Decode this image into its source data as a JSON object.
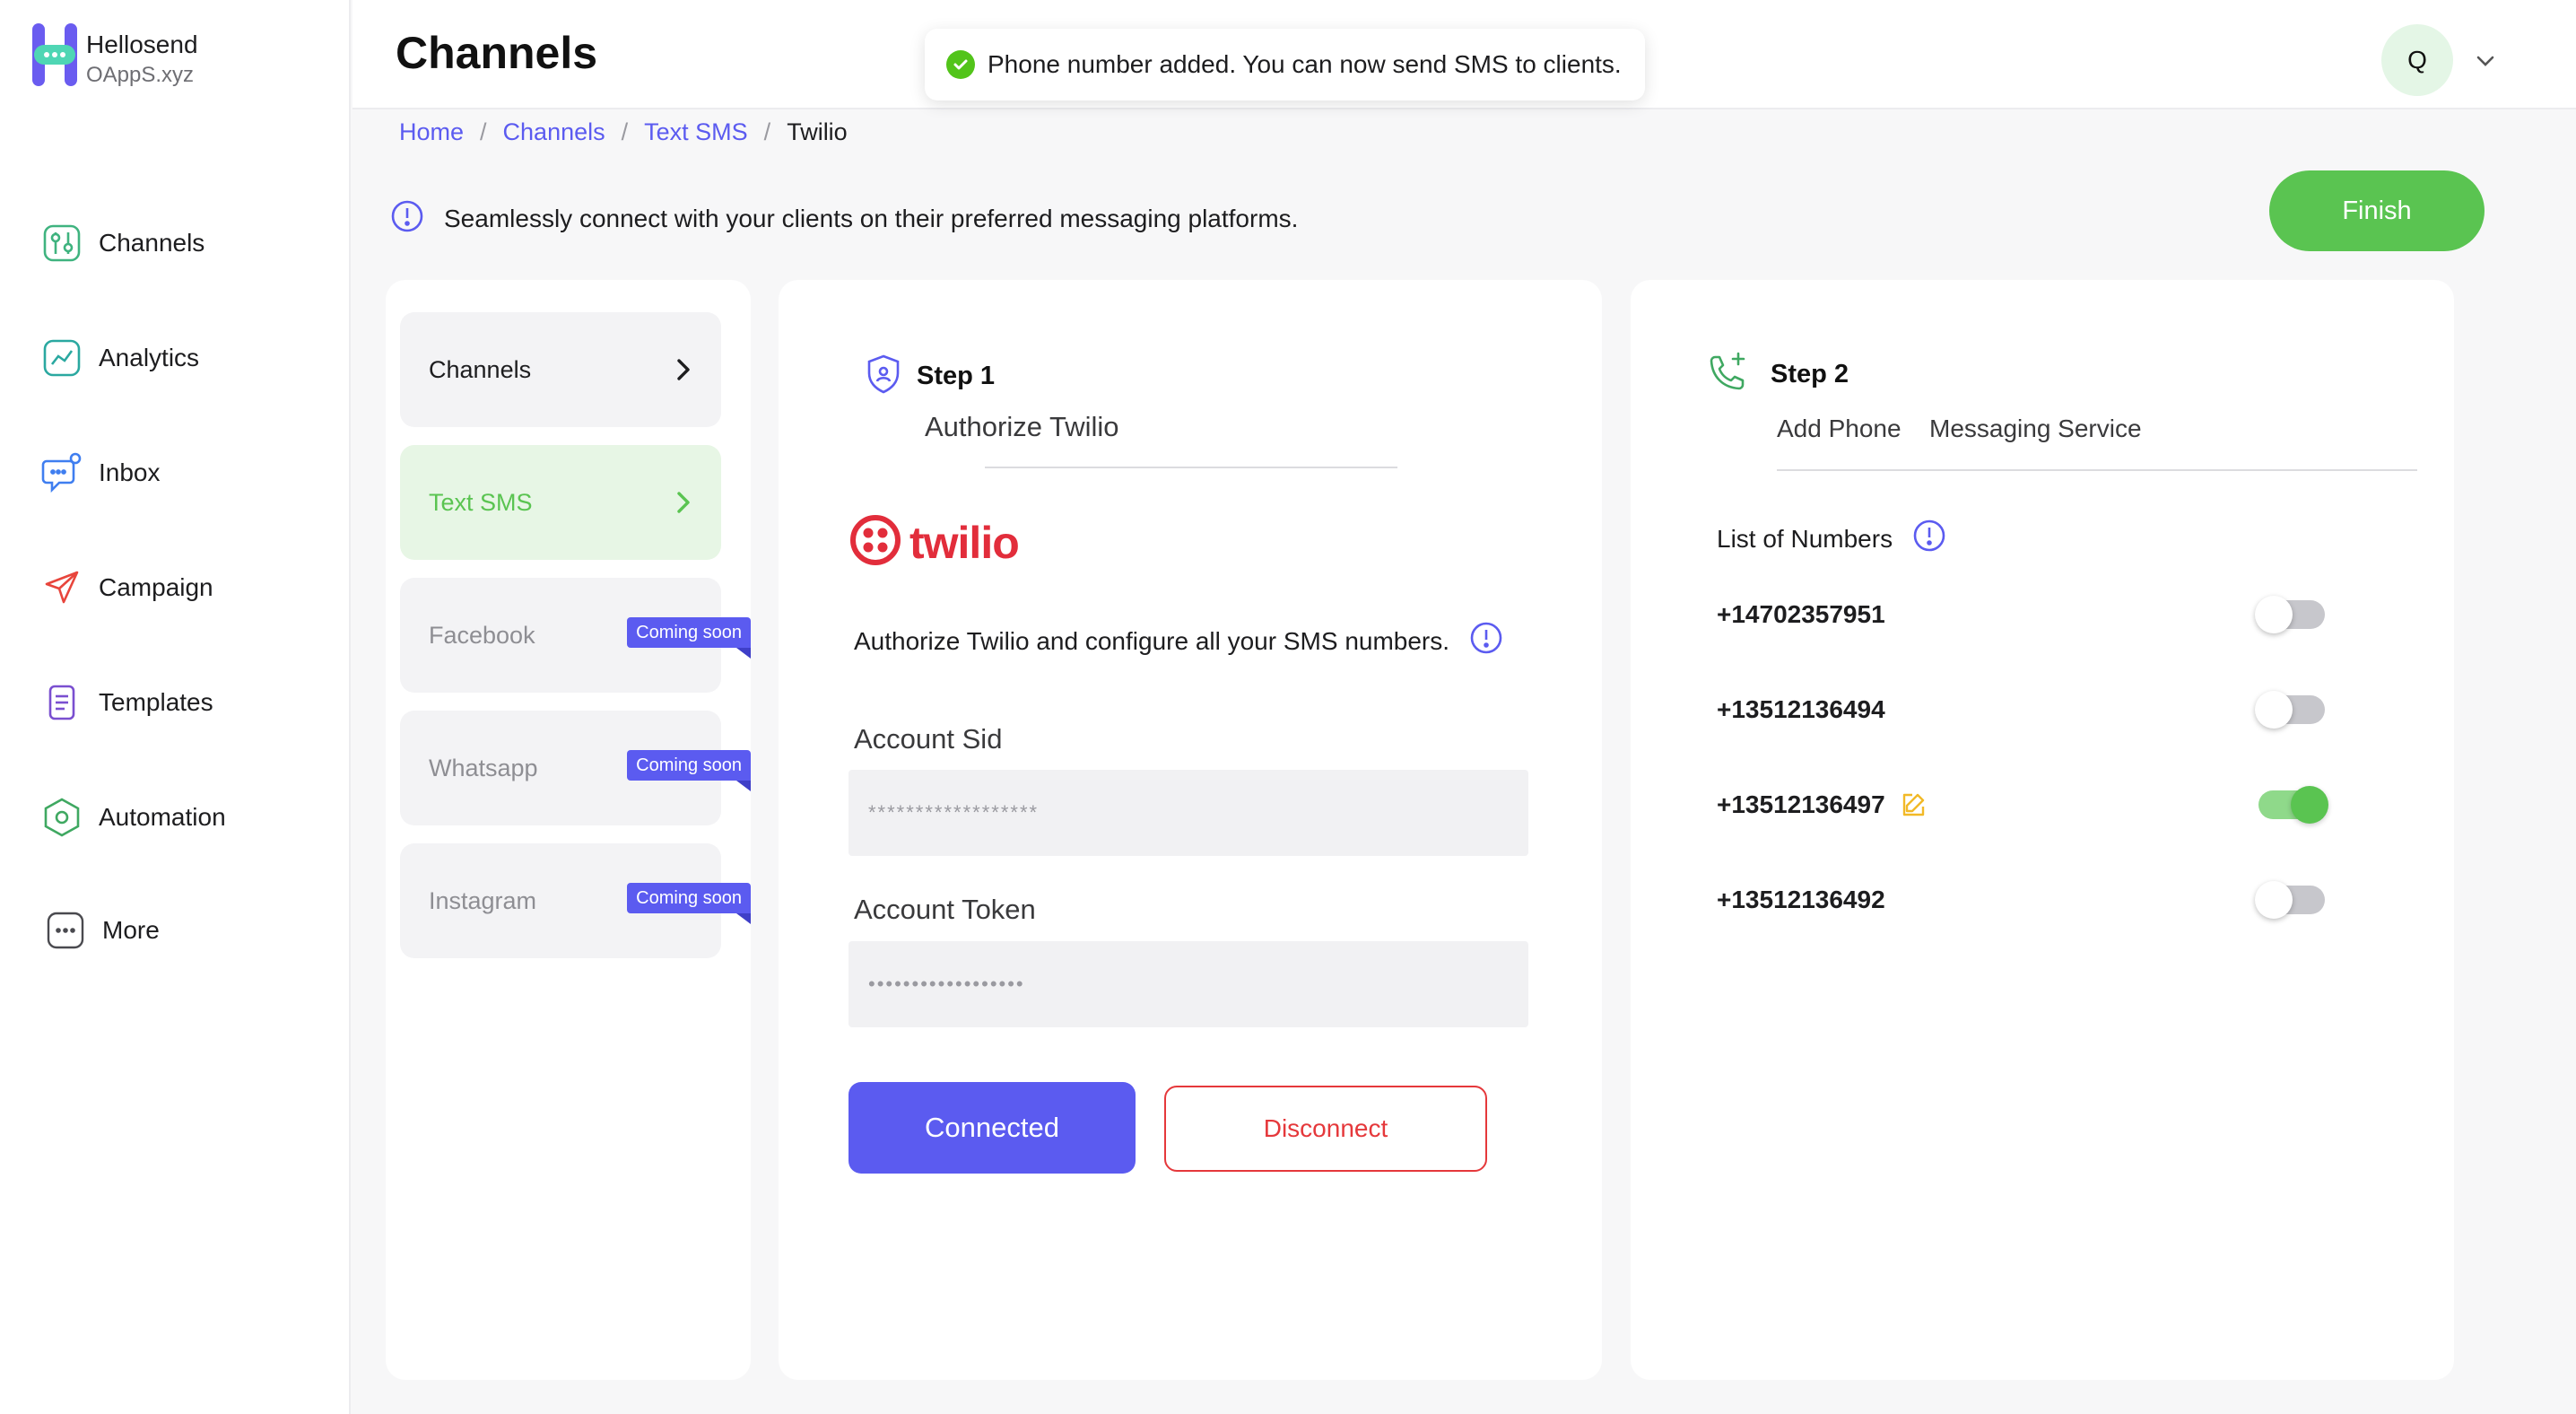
{
  "brand": {
    "name": "Hellosend",
    "sub": "OAppS.xyz"
  },
  "sidebar": {
    "items": [
      {
        "label": "Channels",
        "icon": "sliders-icon"
      },
      {
        "label": "Analytics",
        "icon": "chart-icon"
      },
      {
        "label": "Inbox",
        "icon": "chat-icon"
      },
      {
        "label": "Campaign",
        "icon": "paper-plane-icon"
      },
      {
        "label": "Templates",
        "icon": "document-icon"
      },
      {
        "label": "Automation",
        "icon": "hexagon-icon"
      },
      {
        "label": "More",
        "icon": "more-icon"
      }
    ]
  },
  "header": {
    "title": "Channels",
    "avatar_initial": "Q"
  },
  "toast": {
    "text": "Phone number added. You can now send SMS to clients."
  },
  "breadcrumb": {
    "home": "Home",
    "channels": "Channels",
    "text_sms": "Text SMS",
    "current": "Twilio"
  },
  "info": {
    "text": "Seamlessly connect with your clients on their preferred messaging platforms."
  },
  "finish_label": "Finish",
  "channel_list": [
    {
      "label": "Channels",
      "state": "default"
    },
    {
      "label": "Text SMS",
      "state": "active"
    },
    {
      "label": "Facebook",
      "state": "disabled",
      "badge": "Coming soon"
    },
    {
      "label": "Whatsapp",
      "state": "disabled",
      "badge": "Coming soon"
    },
    {
      "label": "Instagram",
      "state": "disabled",
      "badge": "Coming soon"
    }
  ],
  "step1": {
    "title": "Step 1",
    "subtitle": "Authorize Twilio",
    "logo_text": "twilio",
    "description": "Authorize Twilio and configure all your SMS numbers.",
    "sid_label": "Account Sid",
    "sid_value": "******************",
    "token_label": "Account Token",
    "token_value": "••••••••••••••••••",
    "connected_label": "Connected",
    "disconnect_label": "Disconnect"
  },
  "step2": {
    "title": "Step 2",
    "tabs": [
      "Add Phone",
      "Messaging Service"
    ],
    "list_title": "List of Numbers",
    "numbers": [
      {
        "number": "+14702357951",
        "enabled": false,
        "editable": false
      },
      {
        "number": "+13512136494",
        "enabled": false,
        "editable": false
      },
      {
        "number": "+13512136497",
        "enabled": true,
        "editable": true
      },
      {
        "number": "+13512136492",
        "enabled": false,
        "editable": false
      }
    ]
  },
  "colors": {
    "primary": "#5b5bf0",
    "success": "#5ac451",
    "danger": "#e5383b",
    "twilio": "#e22d3b"
  }
}
